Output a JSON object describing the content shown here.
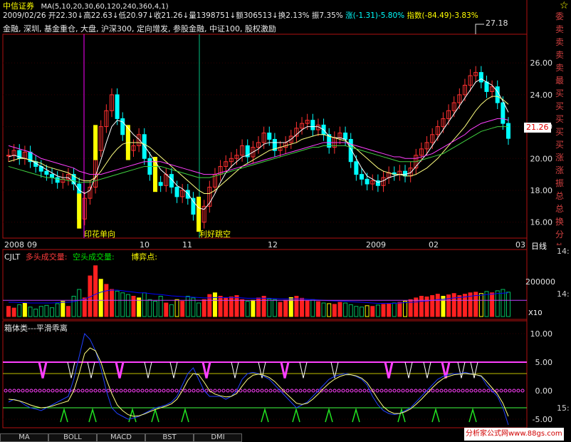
{
  "header": {
    "title": "中信证券",
    "ma_label": "MA(5,10,20,30,60,120,240,360,4,1)",
    "line2": "2009/02/26  开22.30↓高22.63↓低20.97↓收21.26↓量1398751↓额306513↓换2.13%  振7.35%",
    "line2_change": "涨(-1.31)-5.80%",
    "line2_index": "指数(-84.49)-3.83%",
    "line3": "金融, 深圳, 基金重仓, 大盘, 沪深300, 定向增发, 参股金融, 中证100, 股权激励",
    "star": "☆"
  },
  "annotations": {
    "high_value": "27.18",
    "price_tag": "21.26",
    "event1": "印花单向",
    "event2": "利好跳空"
  },
  "date_axis": [
    "2008",
    "09",
    "10",
    "11",
    "12",
    "2009",
    "02",
    "03"
  ],
  "date_axis_right": "日线",
  "volume_panel": {
    "label": "CJLT",
    "l1": "多头成交量:",
    "l2": "空头成交量:",
    "l3": "博弈点:",
    "ytick": "200000",
    "unit": "X10"
  },
  "ind_panel": {
    "title": "箱体类---平滑乖离"
  },
  "tabs": [
    "MA",
    "BOLL",
    "MACD",
    "BST",
    "DMI"
  ],
  "right_panel": [
    "委",
    "卖",
    "卖",
    "卖",
    "卖",
    "最",
    "买",
    "买",
    "买",
    "买",
    "买",
    "涨",
    "涨",
    "振",
    "总",
    "总",
    "换",
    "分",
    "外"
  ],
  "right_panel_nums": [
    "14:",
    "14:",
    "15:"
  ],
  "watermark": "分析家公式网www.88gs.com",
  "chart_data": {
    "type": "line",
    "price_axis": {
      "ticks": [
        16.0,
        18.0,
        20.0,
        22.0,
        24.0,
        26.0
      ],
      "ylim": [
        15.0,
        27.8
      ]
    },
    "indicator_axis": {
      "ticks": [
        10.0,
        5.0,
        0.0,
        -5.0
      ],
      "ylim": [
        -6.5,
        12.0
      ]
    },
    "last_close": 21.26,
    "high": 27.18,
    "closes": [
      20.2,
      20.5,
      20.0,
      20.4,
      19.8,
      19.5,
      19.2,
      19.0,
      18.8,
      18.5,
      18.7,
      19.0,
      18.4,
      16.2,
      17.5,
      18.2,
      20.5,
      22.0,
      23.0,
      24.0,
      22.5,
      21.5,
      20.5,
      20.8,
      21.5,
      20.0,
      19.0,
      18.5,
      18.3,
      19.0,
      18.2,
      17.6,
      18.0,
      17.5,
      16.5,
      16.0,
      17.0,
      18.2,
      19.0,
      19.5,
      19.8,
      20.0,
      20.2,
      20.8,
      20.1,
      20.7,
      21.0,
      21.6,
      21.2,
      20.5,
      20.7,
      21.0,
      21.4,
      21.9,
      22.2,
      22.4,
      21.8,
      22.1,
      21.5,
      20.7,
      21.3,
      21.6,
      21.2,
      19.8,
      19.0,
      18.7,
      18.4,
      18.6,
      18.3,
      18.8,
      19.1,
      19.0,
      19.2,
      18.9,
      19.4,
      20.2,
      20.6,
      21.0,
      21.5,
      22.0,
      22.5,
      23.0,
      23.5,
      24.0,
      24.6,
      25.2,
      25.4,
      24.8,
      24.2,
      24.5,
      23.5,
      22.2,
      21.26
    ],
    "ma_short": [
      20.1,
      20.2,
      20.1,
      20.0,
      19.9,
      19.7,
      19.5,
      19.3,
      19.1,
      18.9,
      18.8,
      18.8,
      18.5,
      18.0,
      17.8,
      18.0,
      18.9,
      19.9,
      21.0,
      22.0,
      22.4,
      22.3,
      21.9,
      21.5,
      21.2,
      20.8,
      20.3,
      19.8,
      19.3,
      19.0,
      18.7,
      18.3,
      18.1,
      17.8,
      17.3,
      16.9,
      16.8,
      17.2,
      17.8,
      18.5,
      19.1,
      19.5,
      19.8,
      20.1,
      20.2,
      20.4,
      20.6,
      20.9,
      21.0,
      21.0,
      21.0,
      21.0,
      21.2,
      21.5,
      21.8,
      22.0,
      22.0,
      22.0,
      21.8,
      21.4,
      21.3,
      21.3,
      21.2,
      20.6,
      20.0,
      19.4,
      18.9,
      18.7,
      18.5,
      18.6,
      18.8,
      18.9,
      19.0,
      19.0,
      19.1,
      19.5,
      19.9,
      20.3,
      20.8,
      21.3,
      21.8,
      22.3,
      22.8,
      23.3,
      23.8,
      24.3,
      24.8,
      25.0,
      24.8,
      24.6,
      24.2,
      23.6,
      22.9
    ],
    "ma_mid": [
      19.8,
      19.9,
      20.0,
      20.0,
      19.9,
      19.8,
      19.7,
      19.5,
      19.4,
      19.3,
      19.2,
      19.1,
      18.9,
      18.7,
      18.6,
      18.6,
      18.8,
      19.2,
      19.7,
      20.2,
      20.6,
      20.9,
      21.0,
      21.0,
      21.0,
      20.9,
      20.7,
      20.4,
      20.1,
      19.8,
      19.5,
      19.2,
      18.9,
      18.6,
      18.3,
      18.0,
      17.8,
      17.8,
      18.0,
      18.3,
      18.6,
      18.9,
      19.2,
      19.5,
      19.7,
      19.9,
      20.1,
      20.3,
      20.5,
      20.6,
      20.7,
      20.8,
      20.9,
      21.0,
      21.2,
      21.3,
      21.4,
      21.5,
      21.5,
      21.4,
      21.3,
      21.2,
      21.1,
      20.9,
      20.6,
      20.3,
      20.0,
      19.7,
      19.4,
      19.2,
      19.1,
      19.0,
      19.0,
      18.9,
      18.9,
      19.0,
      19.2,
      19.4,
      19.7,
      20.0,
      20.4,
      20.8,
      21.2,
      21.6,
      22.0,
      22.5,
      23.0,
      23.4,
      23.7,
      23.9,
      23.9,
      23.7,
      23.4
    ],
    "ma_long": [
      20.8,
      20.7,
      20.6,
      20.5,
      20.4,
      20.2,
      20.0,
      19.9,
      19.8,
      19.7,
      19.6,
      19.5,
      19.4,
      19.2,
      19.1,
      19.0,
      19.0,
      19.0,
      19.1,
      19.2,
      19.3,
      19.4,
      19.5,
      19.6,
      19.7,
      19.8,
      19.8,
      19.8,
      19.8,
      19.7,
      19.6,
      19.5,
      19.4,
      19.3,
      19.2,
      19.1,
      19.0,
      19.0,
      19.0,
      19.1,
      19.2,
      19.3,
      19.4,
      19.5,
      19.6,
      19.7,
      19.8,
      19.9,
      20.0,
      20.1,
      20.2,
      20.3,
      20.4,
      20.5,
      20.6,
      20.7,
      20.8,
      20.9,
      21.0,
      21.0,
      21.0,
      21.0,
      21.0,
      20.9,
      20.8,
      20.7,
      20.6,
      20.5,
      20.4,
      20.3,
      20.2,
      20.1,
      20.1,
      20.0,
      20.0,
      20.0,
      20.1,
      20.2,
      20.3,
      20.5,
      20.7,
      20.9,
      21.1,
      21.3,
      21.5,
      21.8,
      22.0,
      22.2,
      22.3,
      22.4,
      22.5,
      22.5,
      22.4
    ],
    "ma_vlong": [
      19.5,
      19.4,
      19.3,
      19.2,
      19.1,
      19.0,
      18.9,
      18.8,
      18.8,
      18.7,
      18.7,
      18.6,
      18.6,
      18.5,
      18.5,
      18.5,
      18.6,
      18.7,
      18.8,
      18.9,
      19.0,
      19.1,
      19.2,
      19.3,
      19.4,
      19.5,
      19.5,
      19.5,
      19.5,
      19.4,
      19.3,
      19.2,
      19.1,
      19.0,
      18.9,
      18.8,
      18.8,
      18.8,
      18.9,
      19.0,
      19.1,
      19.2,
      19.3,
      19.4,
      19.5,
      19.6,
      19.7,
      19.8,
      19.9,
      20.0,
      20.1,
      20.2,
      20.3,
      20.4,
      20.5,
      20.6,
      20.7,
      20.7,
      20.8,
      20.8,
      20.8,
      20.8,
      20.8,
      20.7,
      20.6,
      20.5,
      20.4,
      20.3,
      20.2,
      20.1,
      20.0,
      19.9,
      19.8,
      19.8,
      19.8,
      19.8,
      19.9,
      20.0,
      20.1,
      20.2,
      20.3,
      20.5,
      20.7,
      20.9,
      21.1,
      21.3,
      21.5,
      21.7,
      21.8,
      21.9,
      22.0,
      22.0,
      22.0
    ],
    "volumes": [
      30,
      25,
      35,
      40,
      28,
      22,
      30,
      33,
      26,
      38,
      45,
      30,
      60,
      80,
      55,
      120,
      150,
      110,
      95,
      80,
      75,
      70,
      65,
      60,
      55,
      70,
      50,
      45,
      60,
      40,
      35,
      50,
      45,
      60,
      55,
      40,
      50,
      65,
      70,
      60,
      55,
      58,
      62,
      50,
      45,
      48,
      55,
      60,
      52,
      50,
      42,
      48,
      56,
      60,
      54,
      46,
      50,
      44,
      40,
      38,
      36,
      42,
      40,
      35,
      30,
      28,
      32,
      30,
      34,
      36,
      38,
      40,
      42,
      45,
      50,
      55,
      60,
      58,
      62,
      66,
      60,
      64,
      68,
      62,
      66,
      70,
      72,
      68,
      74,
      70,
      76,
      80,
      72
    ],
    "volume_avg": [
      42,
      42,
      41,
      41,
      40,
      40,
      40,
      40,
      40,
      41,
      42,
      42,
      44,
      48,
      52,
      58,
      66,
      72,
      76,
      78,
      78,
      76,
      74,
      72,
      70,
      70,
      68,
      66,
      65,
      63,
      61,
      60,
      59,
      58,
      57,
      56,
      55,
      55,
      56,
      56,
      56,
      56,
      56,
      55,
      54,
      54,
      54,
      54,
      54,
      53,
      52,
      52,
      52,
      52,
      52,
      51,
      50,
      49,
      48,
      47,
      46,
      46,
      45,
      44,
      43,
      42,
      41,
      40,
      39,
      39,
      39,
      39,
      40,
      41,
      42,
      43,
      45,
      46,
      48,
      50,
      51,
      53,
      55,
      56,
      58,
      60,
      62,
      63,
      65,
      66,
      68,
      69,
      70
    ],
    "ind_line1": [
      -2,
      -1.5,
      -1.8,
      -2.5,
      -3,
      -3.2,
      -3.5,
      -3,
      -2.5,
      -2,
      -1.5,
      -1,
      2,
      6,
      10,
      9,
      7,
      4,
      0,
      -3,
      -4,
      -4.5,
      -5,
      -4.8,
      -4.5,
      -4,
      -3.5,
      -3,
      -2.8,
      -2.5,
      -2,
      -1,
      1,
      3,
      4,
      2,
      0,
      -1,
      -1,
      -1,
      -1.5,
      -1,
      0,
      2,
      3,
      3.2,
      3,
      2.5,
      2,
      1,
      0,
      -1,
      -2,
      -3,
      -2.5,
      -2,
      -1,
      0,
      1,
      2,
      2.5,
      2.8,
      3,
      2.8,
      2.5,
      2,
      1,
      -1,
      -2.5,
      -3.5,
      -4,
      -4.2,
      -4,
      -3.5,
      -3,
      -2,
      -1,
      0,
      1,
      2,
      2.5,
      2.8,
      3,
      3,
      3.2,
      3,
      2.8,
      2.5,
      1,
      0,
      -1,
      -3,
      -6
    ],
    "ind_line2": [
      -1.5,
      -1.6,
      -1.8,
      -2.1,
      -2.5,
      -2.8,
      -3,
      -2.9,
      -2.7,
      -2.4,
      -2.1,
      -1.8,
      0,
      3,
      6.5,
      7.5,
      7,
      5,
      2,
      -0.5,
      -2.5,
      -3.5,
      -4.2,
      -4.5,
      -4.4,
      -4.1,
      -3.7,
      -3.3,
      -3,
      -2.7,
      -2.3,
      -1.5,
      0,
      1.8,
      3,
      2.8,
      1.5,
      0,
      -0.6,
      -0.9,
      -1.1,
      -1,
      -0.5,
      0.8,
      2,
      2.7,
      2.9,
      2.7,
      2.3,
      1.6,
      0.6,
      -0.4,
      -1.3,
      -2.2,
      -2.4,
      -2.2,
      -1.5,
      -0.6,
      0.4,
      1.3,
      2,
      2.5,
      2.8,
      2.8,
      2.6,
      2.2,
      1.4,
      0,
      -1.5,
      -2.8,
      -3.6,
      -4,
      -4,
      -3.7,
      -3.2,
      -2.4,
      -1.5,
      -0.5,
      0.5,
      1.4,
      2.1,
      2.5,
      2.8,
      2.9,
      3,
      2.9,
      2.8,
      2.6,
      1.6,
      0.5,
      -0.6,
      -2.2,
      -4.5
    ],
    "ind_upper": 5.0,
    "ind_lower": -3.0,
    "ind_mid_dots": 0.0
  }
}
